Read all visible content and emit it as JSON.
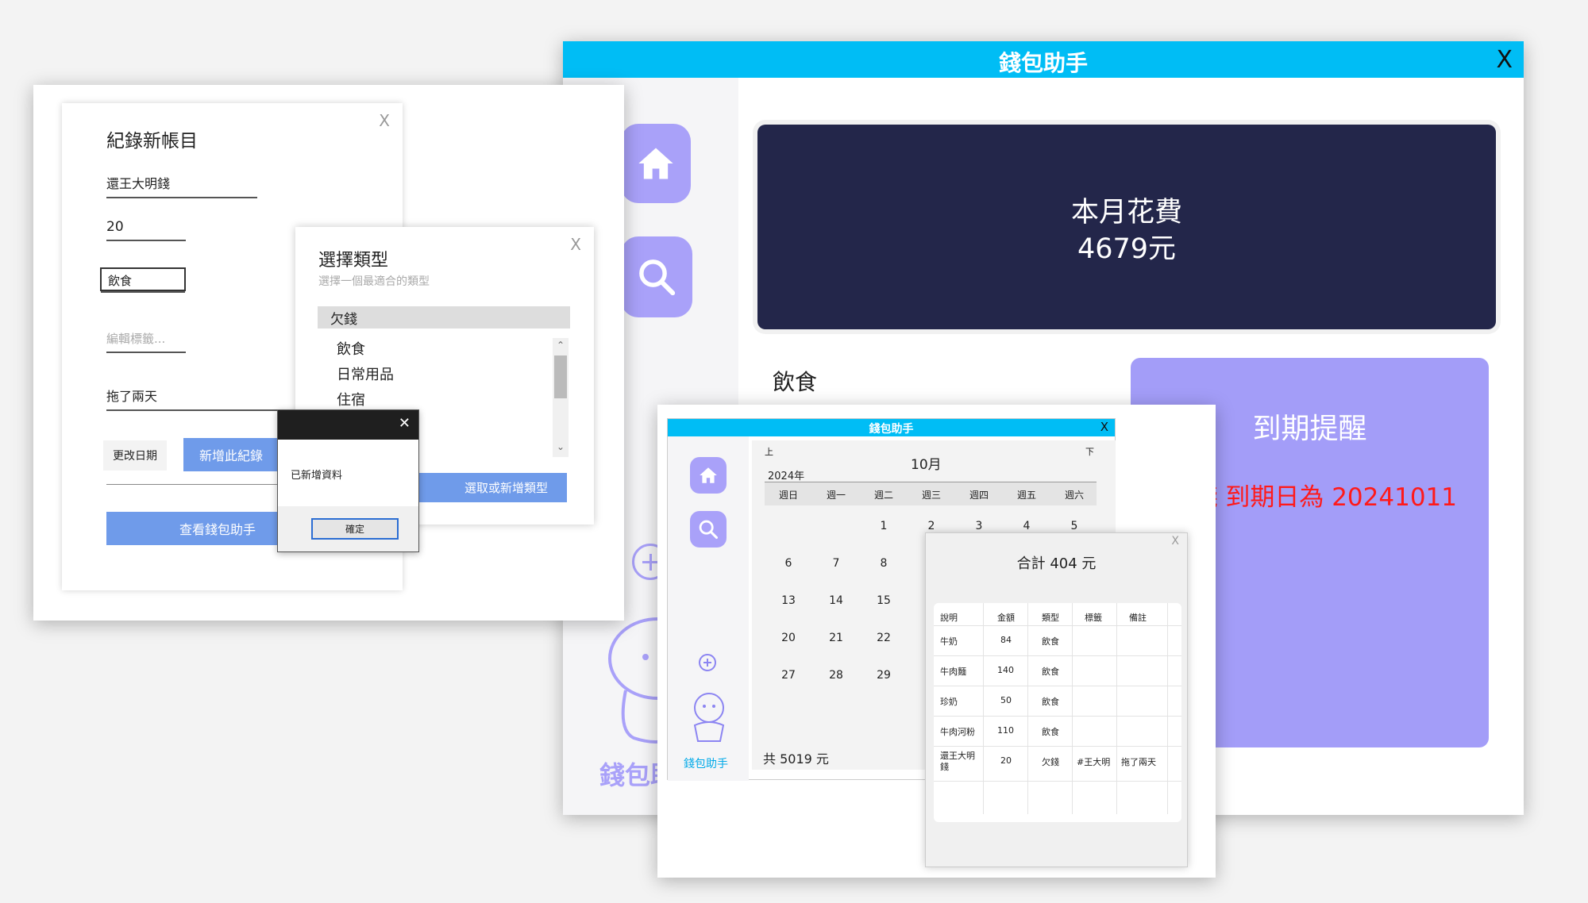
{
  "main_window": {
    "title": "錢包助手",
    "close": "X",
    "spend_card": {
      "label": "本月花費",
      "amount": "4679元"
    },
    "category_heading": "飲食",
    "reminder_card": {
      "title": "到期提醒",
      "message": "錢 到期日為 20241011"
    },
    "brand_text": "錢包助手"
  },
  "record_dialog": {
    "title": "紀錄新帳目",
    "close": "X",
    "description_value": "還王大明錢",
    "amount_value": "20",
    "category_value": "飲食",
    "tag_placeholder": "編輯標籤...",
    "note_value": "拖了兩天",
    "change_date_label": "更改日期",
    "add_record_label": "新增此紀錄",
    "view_wallet_label": "查看錢包助手"
  },
  "type_dialog": {
    "title": "選擇類型",
    "subtitle": "選擇一個最適合的類型",
    "close": "X",
    "selected_item": "欠錢",
    "items": [
      "飲食",
      "日常用品",
      "住宿"
    ],
    "action_label": "選取或新增類型"
  },
  "message_box": {
    "close": "✕",
    "message": "已新增資料",
    "ok_label": "確定"
  },
  "calendar_window": {
    "title": "錢包助手",
    "close": "X",
    "prev": "上",
    "next": "下",
    "month": "10月",
    "year": "2024年",
    "weekdays": [
      "週日",
      "週一",
      "週二",
      "週三",
      "週四",
      "週五",
      "週六"
    ],
    "weeks": [
      [
        "",
        "",
        "1",
        "2",
        "3",
        "4",
        "5"
      ],
      [
        "6",
        "7",
        "8",
        "",
        "",
        "",
        ""
      ],
      [
        "13",
        "14",
        "15",
        "",
        "",
        "",
        ""
      ],
      [
        "20",
        "21",
        "22",
        "",
        "",
        "",
        ""
      ],
      [
        "27",
        "28",
        "29",
        "",
        "",
        "",
        ""
      ]
    ],
    "total": "共 5019 元",
    "brand_text": "錢包助手"
  },
  "detail_popup": {
    "close": "X",
    "total": "合計 404 元",
    "headers": [
      "說明",
      "金額",
      "類型",
      "標籤",
      "備註"
    ],
    "rows": [
      [
        "牛奶",
        "84",
        "飲食",
        "",
        ""
      ],
      [
        "牛肉麵",
        "140",
        "飲食",
        "",
        ""
      ],
      [
        "珍奶",
        "50",
        "飲食",
        "",
        ""
      ],
      [
        "牛肉河粉",
        "110",
        "飲食",
        "",
        ""
      ],
      [
        "還王大明錢",
        "20",
        "欠錢",
        "#王大明",
        "拖了兩天"
      ]
    ]
  },
  "colors": {
    "title_bar": "#00bdf5",
    "spend_card": "#23264a",
    "reminder_card": "#a39df8",
    "icon_tile": "#a9a1f9",
    "primary_button": "#6f9bea",
    "reminder_text": "#ff1a1a"
  }
}
